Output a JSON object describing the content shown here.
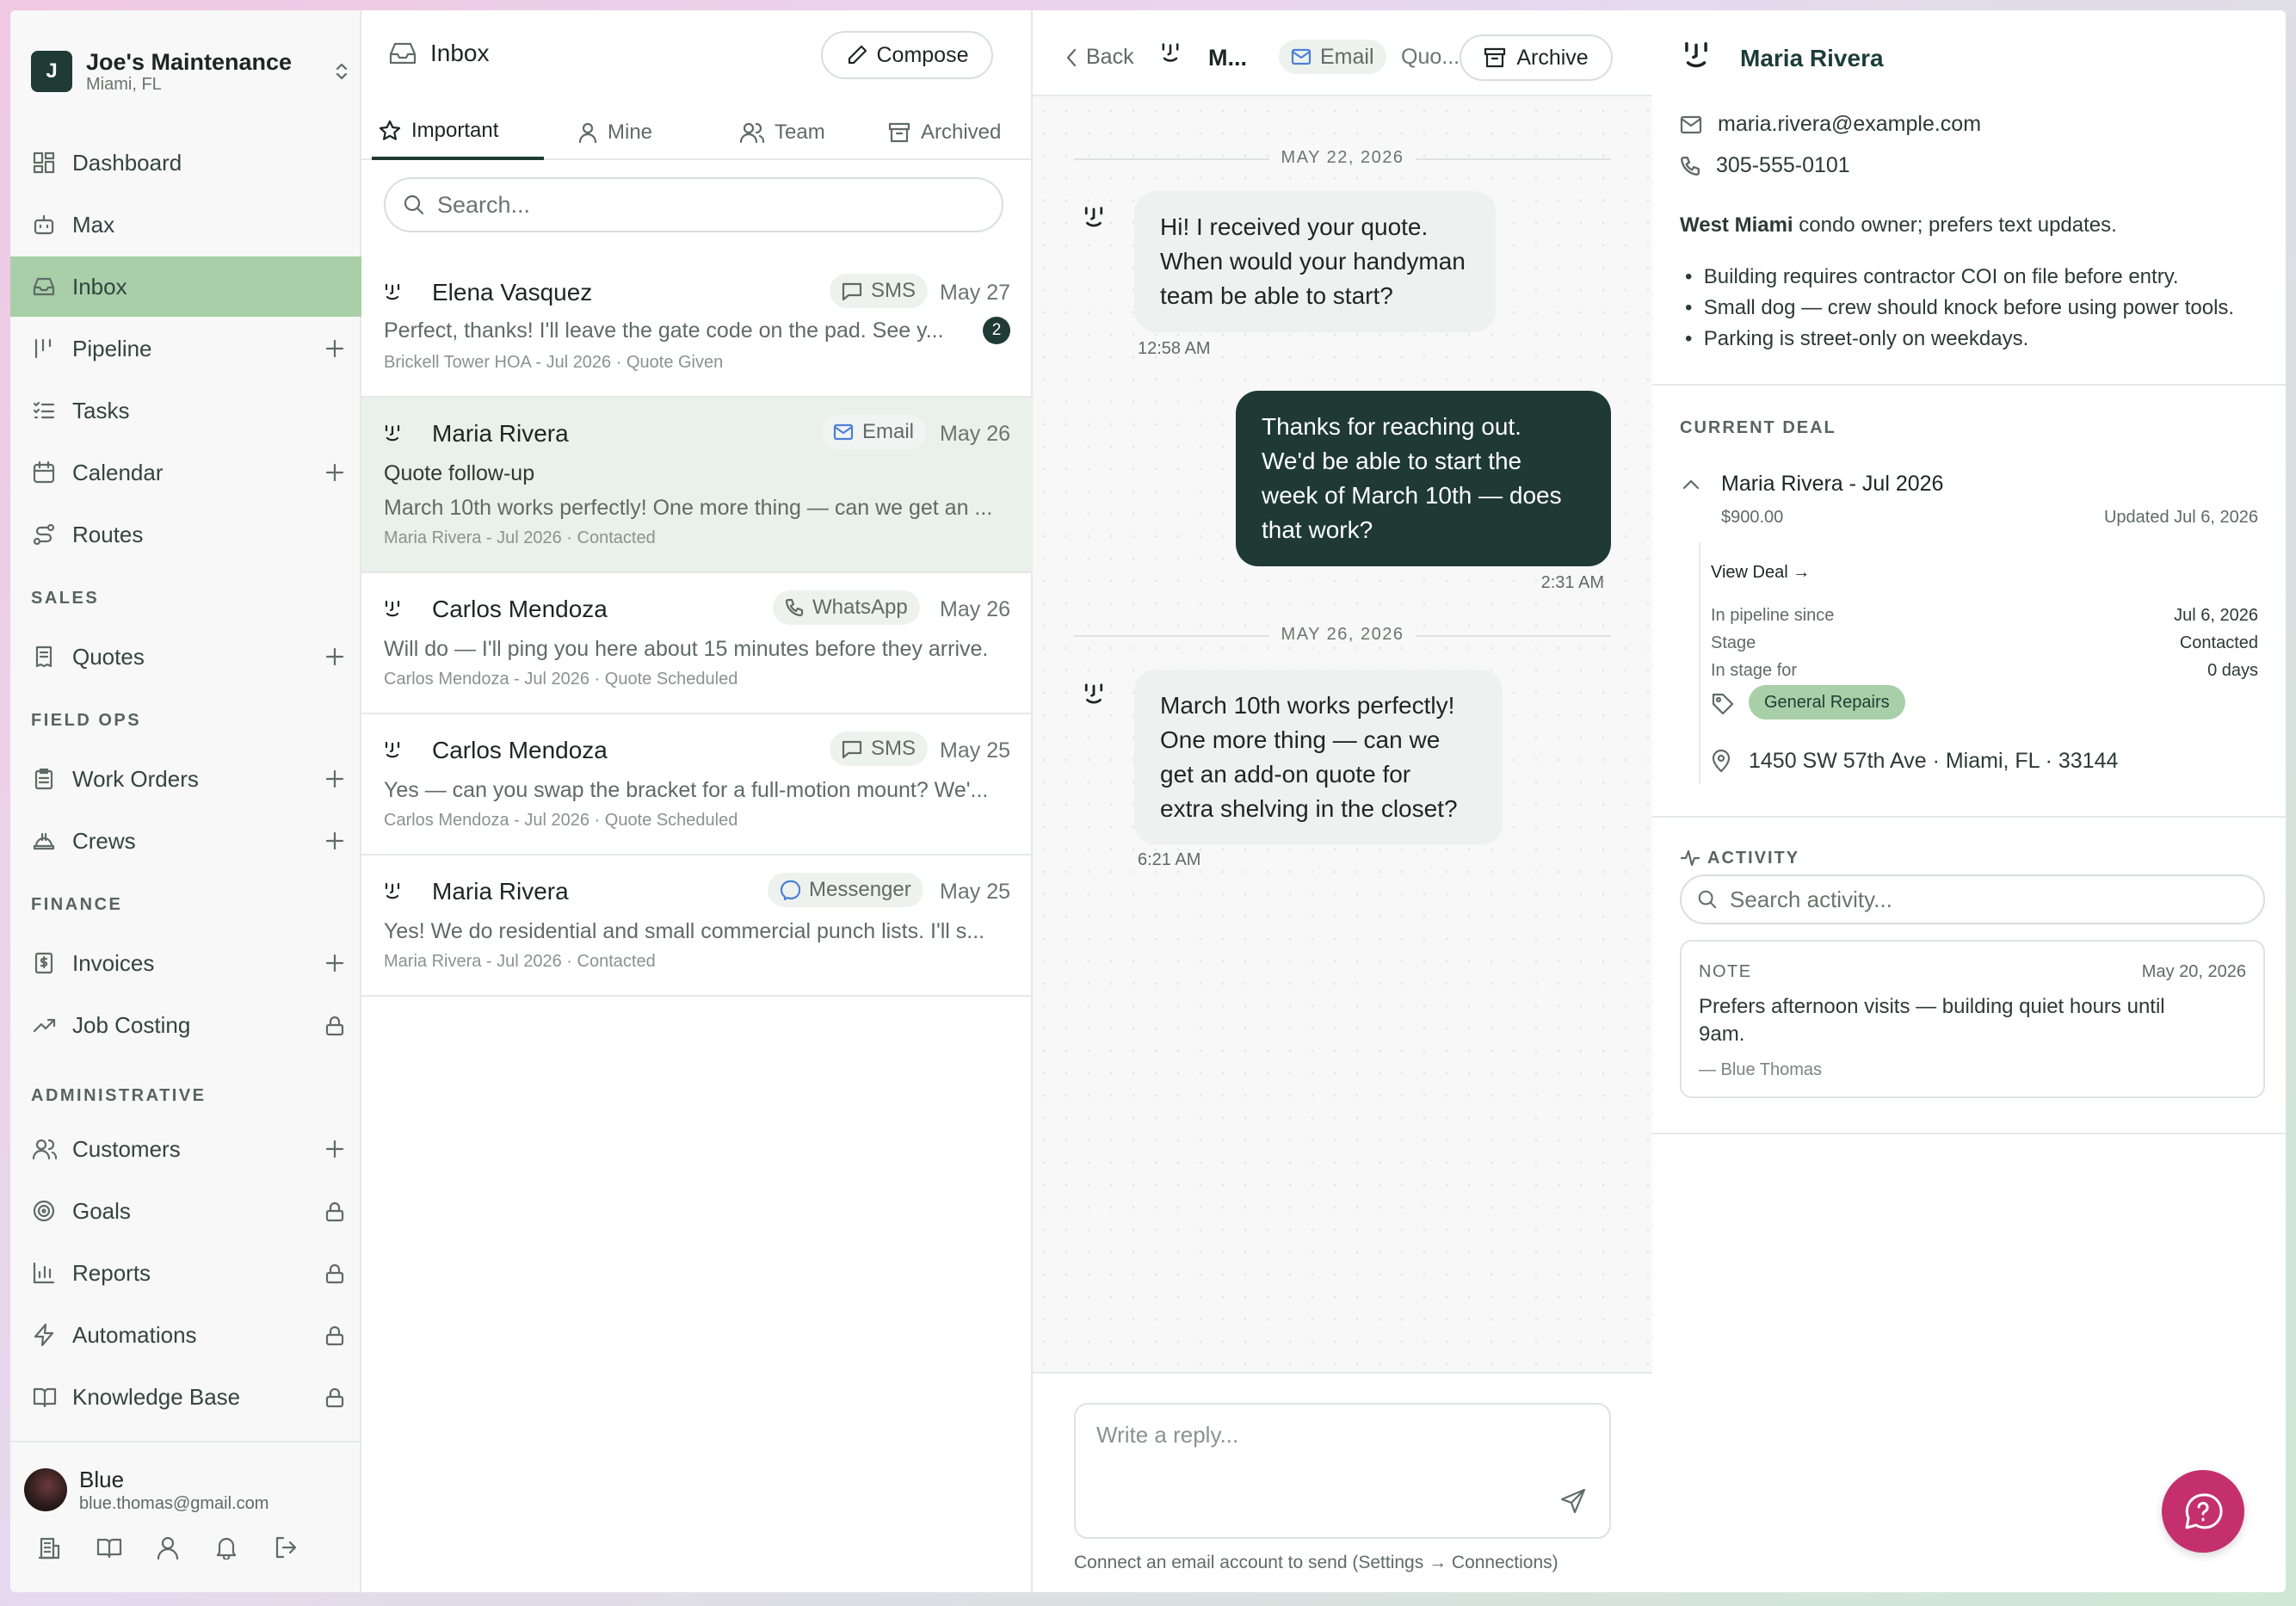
{
  "workspace": {
    "name": "Joe's Maintenance",
    "location": "Miami, FL",
    "initial": "J"
  },
  "nav": {
    "dashboard": "Dashboard",
    "max": "Max",
    "inbox": "Inbox",
    "pipeline": "Pipeline",
    "tasks": "Tasks",
    "calendar": "Calendar",
    "routes": "Routes",
    "sales_heading": "SALES",
    "quotes": "Quotes",
    "field_heading": "FIELD OPS",
    "work_orders": "Work Orders",
    "crews": "Crews",
    "finance_heading": "FINANCE",
    "invoices": "Invoices",
    "job_costing": "Job Costing",
    "admin_heading": "ADMINISTRATIVE",
    "customers": "Customers",
    "goals": "Goals",
    "reports": "Reports",
    "automations": "Automations",
    "knowledge_base": "Knowledge Base"
  },
  "user": {
    "name": "Blue",
    "email": "blue.thomas@gmail.com"
  },
  "inbox": {
    "title": "Inbox",
    "compose": "Compose",
    "tabs": [
      "Important",
      "Mine",
      "Team",
      "Archived"
    ],
    "search_placeholder": "Search...",
    "conversations": [
      {
        "name": "Elena Vasquez",
        "channel": "SMS",
        "date": "May 27",
        "subject": "",
        "preview": "Perfect, thanks! I'll leave the gate code on the pad. See y...",
        "meta": "Brickell Tower HOA - Jul 2026 · Quote Given",
        "unread": "2"
      },
      {
        "name": "Maria Rivera",
        "channel": "Email",
        "date": "May 26",
        "subject": "Quote follow-up",
        "preview": "March 10th works perfectly! One more thing — can we get an ...",
        "meta": "Maria Rivera - Jul 2026 · Contacted",
        "unread": ""
      },
      {
        "name": "Carlos Mendoza",
        "channel": "WhatsApp",
        "date": "May 26",
        "subject": "",
        "preview": "Will do — I'll ping you here about 15 minutes before they arrive.",
        "meta": "Carlos Mendoza - Jul 2026 · Quote Scheduled",
        "unread": ""
      },
      {
        "name": "Carlos Mendoza",
        "channel": "SMS",
        "date": "May 25",
        "subject": "",
        "preview": "Yes — can you swap the bracket for a full-motion mount? We'...",
        "meta": "Carlos Mendoza - Jul 2026 · Quote Scheduled",
        "unread": ""
      },
      {
        "name": "Maria Rivera",
        "channel": "Messenger",
        "date": "May 25",
        "subject": "",
        "preview": "Yes! We do residential and small commercial punch lists. I'll s...",
        "meta": "Maria Rivera - Jul 2026 · Contacted",
        "unread": ""
      }
    ]
  },
  "thread": {
    "back": "Back",
    "name": "M...",
    "channel": "Email",
    "subject": "Quo...",
    "archive": "Archive",
    "dates": [
      "MAY 22, 2026",
      "MAY 26, 2026"
    ],
    "messages": [
      {
        "lines": [
          "Hi! I received your quote.",
          "When would your handyman",
          "team be able to start?"
        ],
        "time": "12:58 AM"
      },
      {
        "lines": [
          "Thanks for reaching out.",
          "We'd be able to start the",
          "week of March 10th — does",
          "that work?"
        ],
        "time": "2:31 AM"
      },
      {
        "lines": [
          "March 10th works perfectly!",
          "One more thing — can we",
          "get an add-on quote for",
          "extra shelving in the closet?"
        ],
        "time": "6:21 AM"
      }
    ],
    "reply_placeholder": "Write a reply...",
    "hint": "Connect an email account to send (Settings → Connections)"
  },
  "contact": {
    "name": "Maria Rivera",
    "email": "maria.rivera@example.com",
    "phone": "305-555-0101",
    "desc_bold": "West Miami",
    "desc_rest": " condo owner; prefers text updates.",
    "notes": [
      "Building requires contractor COI on file before entry.",
      "Small dog — crew should knock before using power tools.",
      "Parking is street-only on weekdays."
    ]
  },
  "deal": {
    "heading": "CURRENT DEAL",
    "name": "Maria Rivera - Jul 2026",
    "amount": "$900.00",
    "updated": "Updated Jul 6, 2026",
    "view": "View Deal →",
    "pipeline_label": "In pipeline since",
    "pipeline_value": "Jul 6, 2026",
    "stage_label": "Stage",
    "stage_value": "Contacted",
    "instage_label": "In stage for",
    "instage_value": "0 days",
    "tag": "General Repairs",
    "address": "1450 SW 57th Ave · Miami, FL · 33144"
  },
  "activity": {
    "heading": "ACTIVITY",
    "search_placeholder": "Search activity...",
    "note_label": "NOTE",
    "note_date": "May 20, 2026",
    "note_lines": [
      "Prefers afternoon visits — building quiet hours until",
      "9am."
    ],
    "note_author": "— Blue Thomas"
  },
  "colors": {
    "accent": "#1e3a33",
    "active_nav": "#a8cfa7",
    "fab": "#c4306e"
  }
}
